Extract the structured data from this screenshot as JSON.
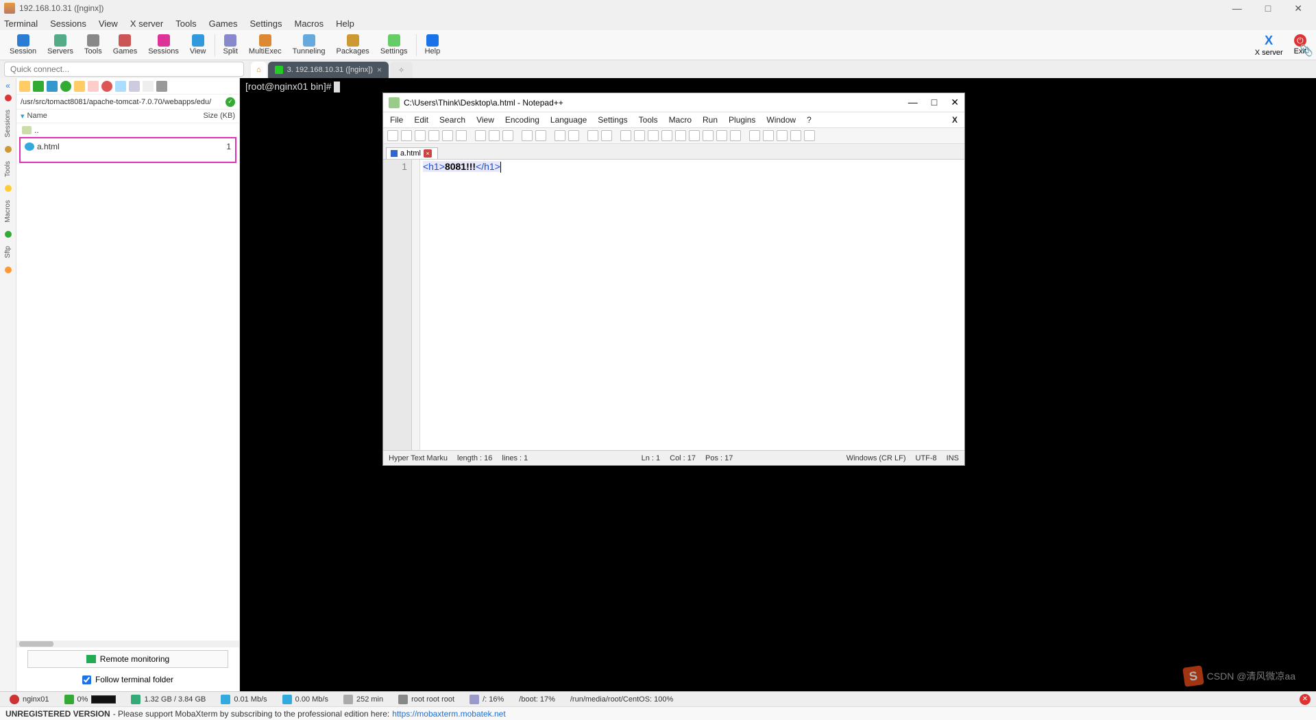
{
  "window": {
    "title": "192.168.10.31 ([nginx])",
    "min": "—",
    "max": "□",
    "close": "✕"
  },
  "menubar": [
    "Terminal",
    "Sessions",
    "View",
    "X server",
    "Tools",
    "Games",
    "Settings",
    "Macros",
    "Help"
  ],
  "toolbar": [
    {
      "label": "Session",
      "icon": "ic-session"
    },
    {
      "label": "Servers",
      "icon": "ic-servers"
    },
    {
      "label": "Tools",
      "icon": "ic-tools"
    },
    {
      "label": "Games",
      "icon": "ic-games"
    },
    {
      "label": "Sessions",
      "icon": "ic-sessions2"
    },
    {
      "label": "View",
      "icon": "ic-view"
    },
    {
      "label": "Split",
      "icon": "ic-split"
    },
    {
      "label": "MultiExec",
      "icon": "ic-multi"
    },
    {
      "label": "Tunneling",
      "icon": "ic-tunneling"
    },
    {
      "label": "Packages",
      "icon": "ic-packages"
    },
    {
      "label": "Settings",
      "icon": "ic-settings"
    },
    {
      "label": "Help",
      "icon": "ic-help"
    }
  ],
  "toolbar_right": {
    "xserver": "X server",
    "exit": "Exit"
  },
  "quickconnect": {
    "placeholder": "Quick connect..."
  },
  "sidetabs": [
    "Sessions",
    "Tools",
    "Macros",
    "Sftp"
  ],
  "filepanel": {
    "path": "/usr/src/tomact8081/apache-tomcat-7.0.70/webapps/edu/",
    "cols": {
      "name": "Name",
      "size": "Size (KB)"
    },
    "parent": "..",
    "files": [
      {
        "name": "a.html",
        "size": "1"
      }
    ],
    "remote_btn": "Remote monitoring",
    "follow_label": "Follow terminal folder"
  },
  "termtabs": {
    "home": "⌂",
    "tab": "3. 192.168.10.31 ([nginx])"
  },
  "terminal": {
    "prompt": "[root@nginx01 bin]# "
  },
  "npp": {
    "title": "C:\\Users\\Think\\Desktop\\a.html - Notepad++",
    "menu": [
      "File",
      "Edit",
      "Search",
      "View",
      "Encoding",
      "Language",
      "Settings",
      "Tools",
      "Macro",
      "Run",
      "Plugins",
      "Window",
      "?"
    ],
    "filetab": "a.html",
    "line_no": "1",
    "code": {
      "open": "<h1>",
      "text": "8081!!!",
      "close": "</h1>"
    },
    "status": {
      "lang": "Hyper Text Marku",
      "length": "length : 16",
      "lines": "lines : 1",
      "ln": "Ln : 1",
      "col": "Col : 17",
      "pos": "Pos : 17",
      "eol": "Windows (CR LF)",
      "enc": "UTF-8",
      "ins": "INS"
    }
  },
  "statbar": {
    "host": "nginx01",
    "cpu": "0%",
    "mem": "1.32 GB / 3.84 GB",
    "up": "0.01 Mb/s",
    "down": "0.00 Mb/s",
    "uptime": "252 min",
    "user": "root  root  root",
    "disk1": "/: 16%",
    "disk2": "/boot: 17%",
    "disk3": "/run/media/root/CentOS: 100%"
  },
  "footer": {
    "unreg": "UNREGISTERED VERSION",
    "msg": "-   Please support MobaXterm by subscribing to the professional edition here:",
    "url": "https://mobaxterm.mobatek.net"
  },
  "watermark": "CSDN @清风微凉aa"
}
